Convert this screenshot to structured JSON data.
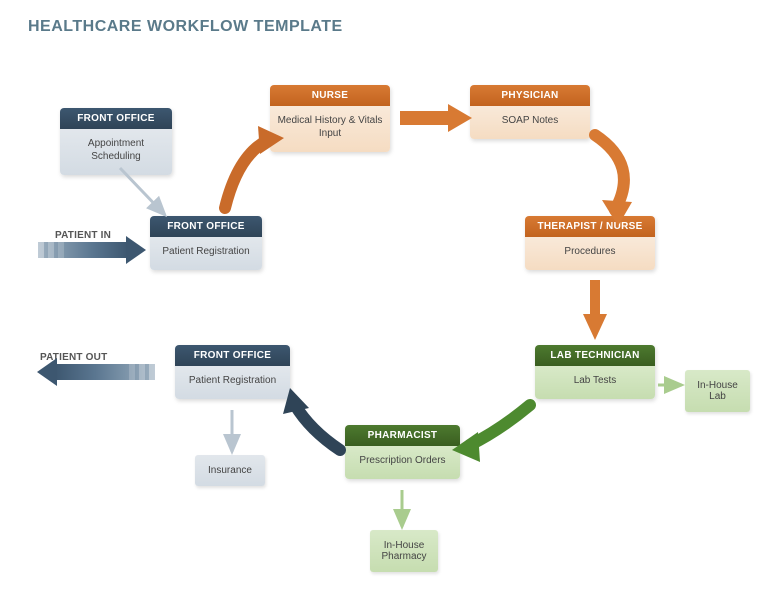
{
  "title": "HEALTHCARE WORKFLOW TEMPLATE",
  "labels": {
    "patient_in": "PATIENT IN",
    "patient_out": "PATIENT OUT"
  },
  "nodes": {
    "appt": {
      "header": "FRONT OFFICE",
      "body": "Appointment Scheduling"
    },
    "reg1": {
      "header": "FRONT OFFICE",
      "body": "Patient Registration"
    },
    "nurse": {
      "header": "NURSE",
      "body": "Medical History & Vitals Input"
    },
    "phys": {
      "header": "PHYSICIAN",
      "body": "SOAP Notes"
    },
    "ther": {
      "header": "THERAPIST / NURSE",
      "body": "Procedures"
    },
    "labtech": {
      "header": "LAB TECHNICIAN",
      "body": "Lab Tests"
    },
    "pharm": {
      "header": "PHARMACIST",
      "body": "Prescription Orders"
    },
    "reg2": {
      "header": "FRONT OFFICE",
      "body": "Patient Registration"
    }
  },
  "simple": {
    "inhouse_lab": "In-House Lab",
    "inhouse_pharm": "In-House Pharmacy",
    "insurance": "Insurance"
  }
}
